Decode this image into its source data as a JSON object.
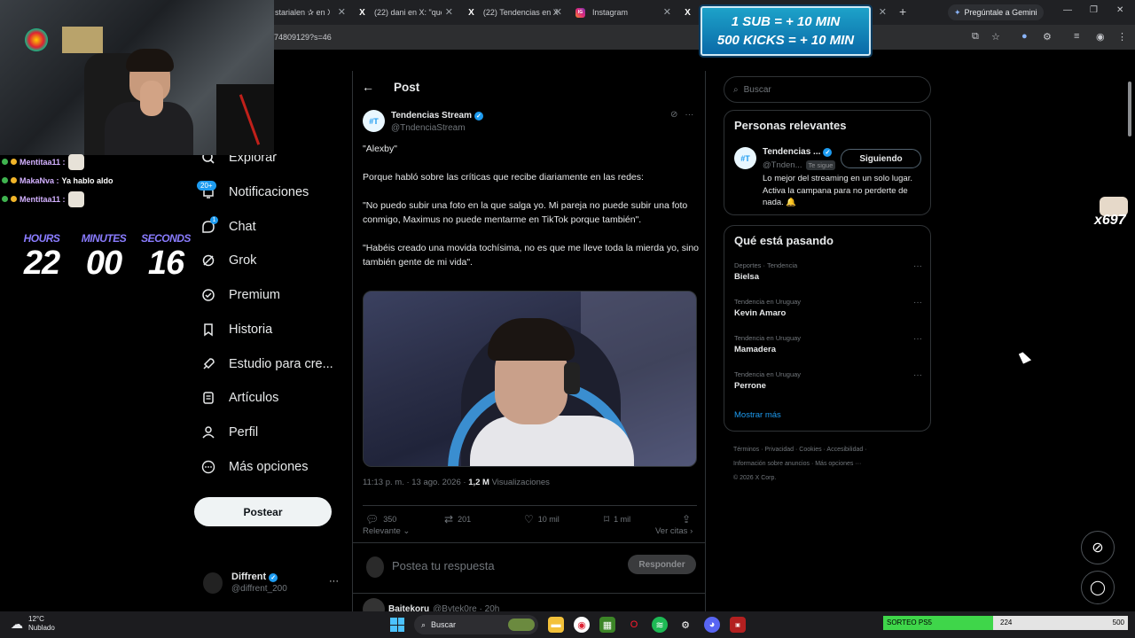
{
  "browser": {
    "tabs": [
      {
        "title": "starialen ✰ en X",
        "favicon": ""
      },
      {
        "title": "(22) dani en X: \"que l",
        "favicon": "X"
      },
      {
        "title": "(22) Tendencias en X",
        "favicon": "X"
      },
      {
        "title": "Instagram",
        "favicon": "IG"
      },
      {
        "title": "",
        "favicon": "X"
      }
    ],
    "gemini_label": "Pregúntale a Gemini",
    "url": "74809129?s=46"
  },
  "overlay": {
    "chat": [
      {
        "user": "Mentitaa11 :",
        "message": "",
        "badge_color": "#3fb34f"
      },
      {
        "user": "MakaNva :",
        "message": "Ya hablo aldo",
        "badge_color": "#f0b429"
      },
      {
        "user": "Mentitaa11 :",
        "message": "",
        "badge_color": "#3fb34f"
      }
    ],
    "timer": {
      "labels": [
        "HOURS",
        "MINUTES",
        "SECONDS"
      ],
      "hours": "22",
      "minutes": "00",
      "seconds": "16"
    },
    "sub_banner": {
      "line1": "1 SUB = + 10 MIN",
      "line2": "500 KICKS = + 10 MIN"
    },
    "kick_count": "x697"
  },
  "sidebar": {
    "items": [
      {
        "label": "Explorar",
        "icon": "search-icon"
      },
      {
        "label": "Notificaciones",
        "icon": "bell-icon",
        "badge": "20+"
      },
      {
        "label": "Chat",
        "icon": "chat-icon",
        "badge": "1"
      },
      {
        "label": "Grok",
        "icon": "grok-icon"
      },
      {
        "label": "Premium",
        "icon": "premium-icon"
      },
      {
        "label": "Historia",
        "icon": "bookmark-icon"
      },
      {
        "label": "Estudio para cre...",
        "icon": "rocket-icon"
      },
      {
        "label": "Artículos",
        "icon": "article-icon"
      },
      {
        "label": "Perfil",
        "icon": "person-icon"
      },
      {
        "label": "Más opciones",
        "icon": "more-icon"
      }
    ],
    "post_button": "Postear",
    "profile": {
      "name": "Diffrent",
      "handle": "@diffrent_200"
    }
  },
  "post": {
    "header": "Post",
    "author": {
      "name": "Tendencias Stream",
      "handle": "@TndenciaStream",
      "initials": "#T"
    },
    "paragraphs": [
      "\"Alexby\"",
      "Porque habló sobre las críticas que recibe diariamente en las redes:",
      "\"No puedo subir una foto en la que salga yo. Mi pareja no puede subir una foto conmigo, Maximus no puede mentarme en TikTok porque también\".",
      "\"Habéis creado una movida tochísima, no es que me lleve toda la mierda yo, sino también gente de mi vida\"."
    ],
    "meta": {
      "time": "11:13 p. m. · 13 ago. 2026 · ",
      "views": "1,2 M",
      "views_label": " Visualizaciones"
    },
    "stats": {
      "replies": "350",
      "reposts": "201",
      "likes": "10 mil",
      "bookmarks": "1 mil"
    },
    "sort_label": "Relevante",
    "quotes_label": "Ver citas",
    "reply_placeholder": "Postea tu respuesta",
    "reply_button": "Responder",
    "next": {
      "name": "Baitekoru",
      "handle": "@Bytek0re · 20h"
    }
  },
  "right": {
    "search_placeholder": "Buscar",
    "relevant": {
      "title": "Personas relevantes",
      "name": "Tendencias ...",
      "handle": "@Tnden...",
      "follows_you": "Te sigue",
      "button": "Siguiendo",
      "bio": "Lo mejor del streaming en un solo lugar. Activa la campana para no perderte de nada. 🔔",
      "initials": "#T"
    },
    "trends": {
      "title": "Qué está pasando",
      "items": [
        {
          "category": "Deportes · Tendencia",
          "name": "Bielsa"
        },
        {
          "category": "Tendencia en Uruguay",
          "name": "Kevin Amaro"
        },
        {
          "category": "Tendencia en Uruguay",
          "name": "Mamadera"
        },
        {
          "category": "Tendencia en Uruguay",
          "name": "Perrone"
        }
      ],
      "show_more": "Mostrar más"
    },
    "footer": {
      "line1": "Términos · Privacidad · Cookies · Accesibilidad ·",
      "line2": "Información sobre anuncios · Más opciones ···",
      "line3": "© 2026 X Corp."
    }
  },
  "taskbar": {
    "temperature": "12°C",
    "condition": "Nublado",
    "search": "Buscar",
    "sorteo": {
      "label": "SORTEO PS5",
      "current": "224",
      "goal": "500",
      "progress": 0.448
    }
  }
}
